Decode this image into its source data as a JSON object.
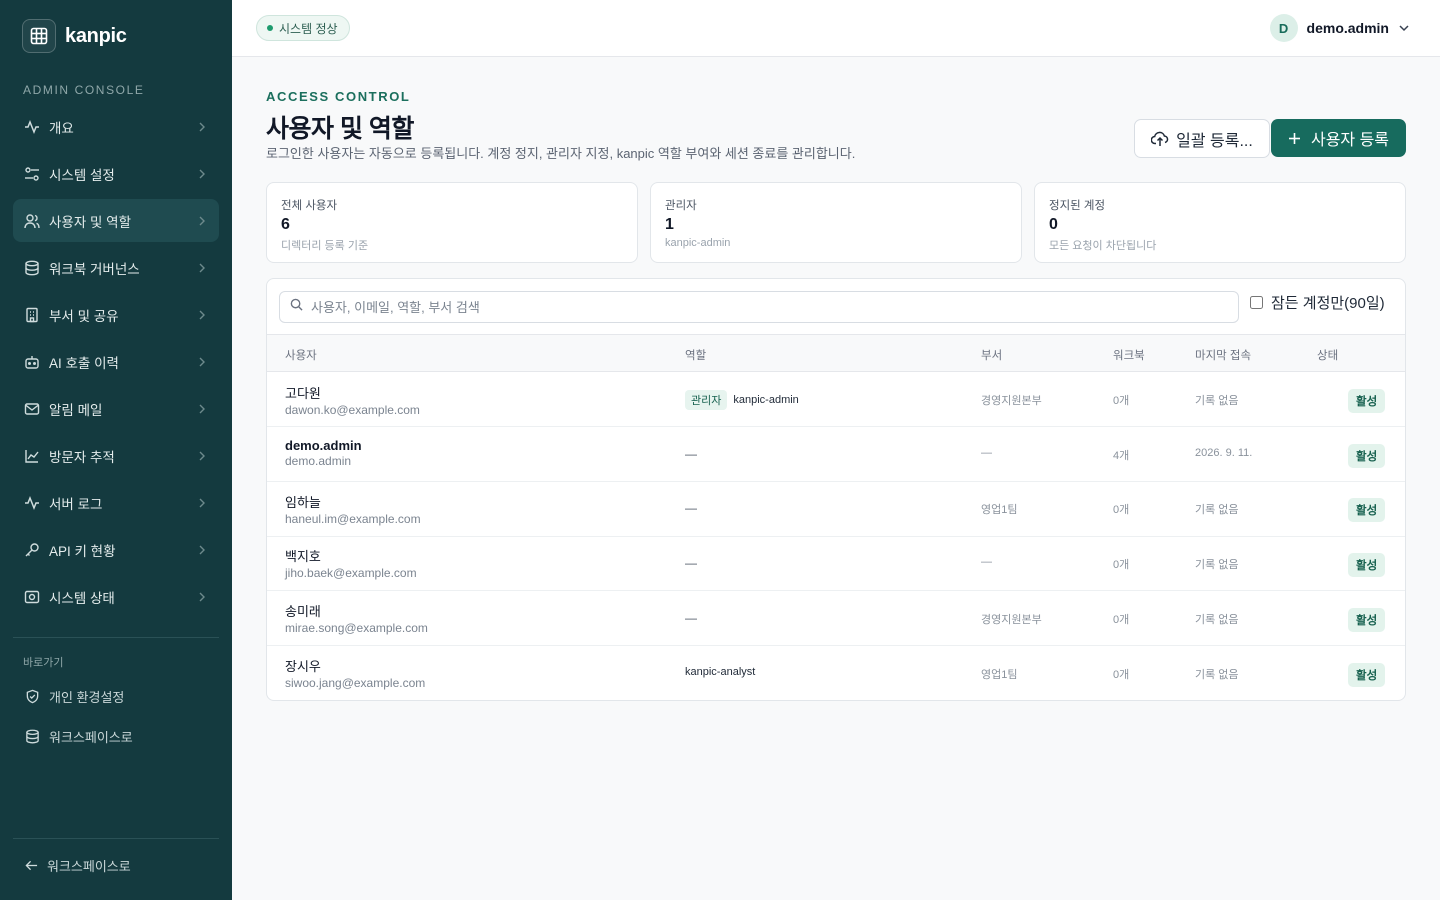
{
  "brand": {
    "name": "kanpic"
  },
  "sidebar": {
    "section_label": "ADMIN CONSOLE",
    "items": [
      {
        "label": "개요",
        "icon": "activity-icon"
      },
      {
        "label": "시스템 설정",
        "icon": "settings-sliders-icon"
      },
      {
        "label": "사용자 및 역할",
        "icon": "users-icon",
        "active": true
      },
      {
        "label": "워크북 거버넌스",
        "icon": "database-icon"
      },
      {
        "label": "부서 및 공유",
        "icon": "building-icon"
      },
      {
        "label": "AI 호출 이력",
        "icon": "bot-icon"
      },
      {
        "label": "알림 메일",
        "icon": "mail-icon"
      },
      {
        "label": "방문자 추적",
        "icon": "line-chart-icon"
      },
      {
        "label": "서버 로그",
        "icon": "pulse-icon"
      },
      {
        "label": "API 키 현황",
        "icon": "key-icon"
      },
      {
        "label": "시스템 상태",
        "icon": "status-camera-icon"
      }
    ],
    "shortcut_label": "바로가기",
    "shortcuts": [
      {
        "label": "개인 환경설정",
        "icon": "shield-icon"
      },
      {
        "label": "워크스페이스로",
        "icon": "database-icon"
      }
    ],
    "back_label": "워크스페이스로"
  },
  "topbar": {
    "status": "시스템 정상",
    "status_color": "#1e9b6e",
    "user_initial": "D",
    "user_name": "demo.admin"
  },
  "header": {
    "eyebrow": "ACCESS CONTROL",
    "title": "사용자 및 역할",
    "description": "로그인한 사용자는 자동으로 등록됩니다. 계정 정지, 관리자 지정, kanpic 역할 부여와 세션 종료를 관리합니다.",
    "bulk_button": "일괄 등록...",
    "add_button": "사용자 등록"
  },
  "stats": [
    {
      "label": "전체 사용자",
      "value": "6",
      "sub": "디렉터리 등록 기준"
    },
    {
      "label": "관리자",
      "value": "1",
      "sub": "kanpic-admin"
    },
    {
      "label": "정지된 계정",
      "value": "0",
      "sub": "모든 요청이 차단됩니다"
    }
  ],
  "table": {
    "search_placeholder": "사용자, 이메일, 역할, 부서 검색",
    "dormant_label": "잠든 계정만(90일)",
    "headers": {
      "user": "사용자",
      "role": "역할",
      "dept": "부서",
      "workbook": "워크북",
      "last_login": "마지막 접속",
      "status": "상태"
    },
    "rows": [
      {
        "name": "고다원",
        "email": "dawon.ko@example.com",
        "role_badge": "관리자",
        "role": "kanpic-admin",
        "dept": "경영지원본부",
        "workbooks": "0개",
        "last_login": "기록 없음",
        "status": "활성"
      },
      {
        "name": "demo.admin",
        "email": "demo.admin",
        "role_badge": "",
        "role": "—",
        "dept": "—",
        "workbooks": "4개",
        "last_login": "2026. 9. 11.",
        "status": "활성"
      },
      {
        "name": "임하늘",
        "email": "haneul.im@example.com",
        "role_badge": "",
        "role": "—",
        "dept": "영업1팀",
        "workbooks": "0개",
        "last_login": "기록 없음",
        "status": "활성"
      },
      {
        "name": "백지호",
        "email": "jiho.baek@example.com",
        "role_badge": "",
        "role": "—",
        "dept": "—",
        "workbooks": "0개",
        "last_login": "기록 없음",
        "status": "활성"
      },
      {
        "name": "송미래",
        "email": "mirae.song@example.com",
        "role_badge": "",
        "role": "—",
        "dept": "경영지원본부",
        "workbooks": "0개",
        "last_login": "기록 없음",
        "status": "활성"
      },
      {
        "name": "장시우",
        "email": "siwoo.jang@example.com",
        "role_badge": "",
        "role": "kanpic-analyst",
        "dept": "영업1팀",
        "workbooks": "0개",
        "last_login": "기록 없음",
        "status": "활성"
      }
    ]
  }
}
